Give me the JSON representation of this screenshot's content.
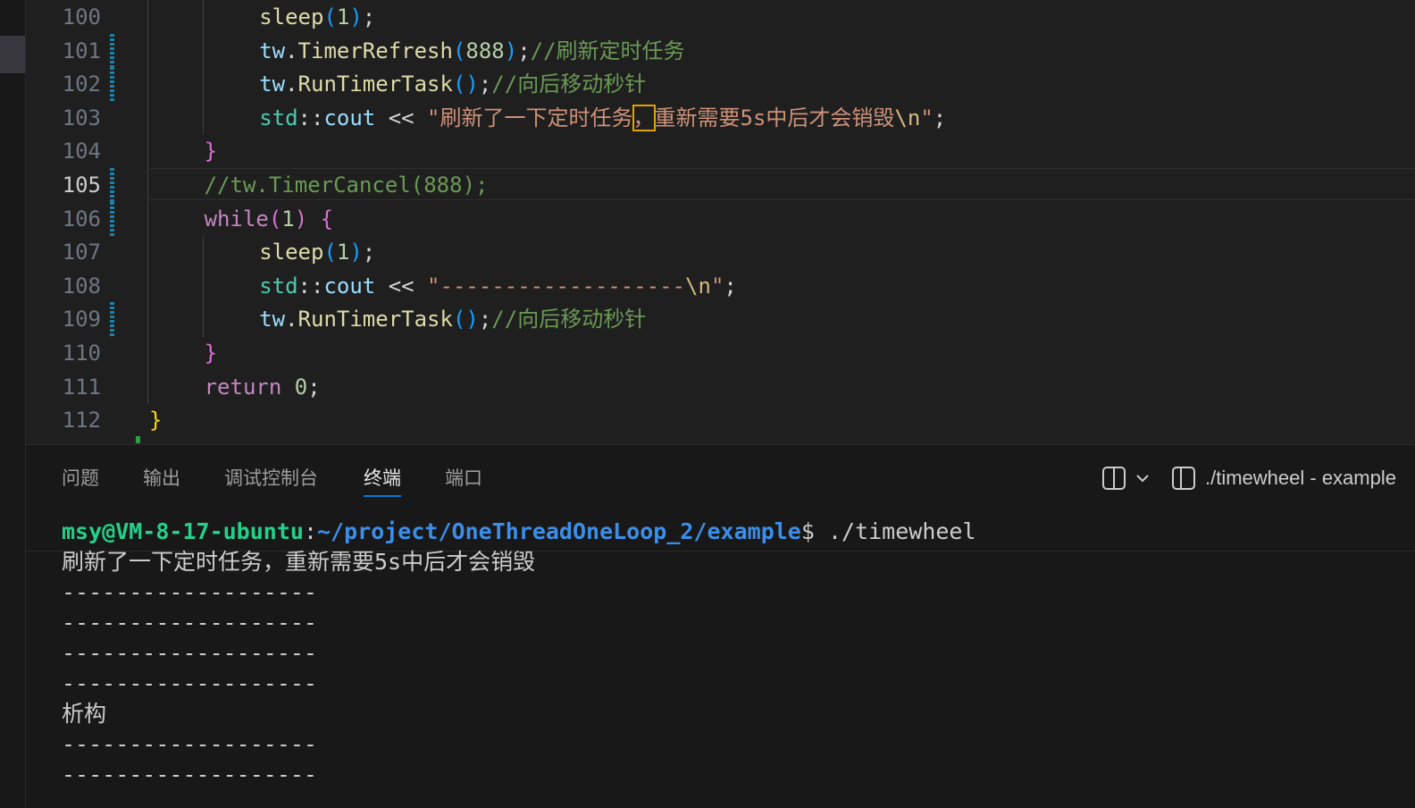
{
  "editor": {
    "lines": [
      {
        "num": "100",
        "indent": "        ",
        "tokens": [
          {
            "t": "sleep",
            "c": "t-fn"
          },
          {
            "t": "(",
            "c": "t-paren"
          },
          {
            "t": "1",
            "c": "t-num"
          },
          {
            "t": ")",
            "c": "t-paren"
          },
          {
            "t": ";",
            "c": "t-op"
          }
        ]
      },
      {
        "num": "101",
        "indent": "        ",
        "modified": true,
        "tokens": [
          {
            "t": "tw",
            "c": "t-var"
          },
          {
            "t": ".",
            "c": "t-op"
          },
          {
            "t": "TimerRefresh",
            "c": "t-fn"
          },
          {
            "t": "(",
            "c": "t-paren"
          },
          {
            "t": "888",
            "c": "t-num"
          },
          {
            "t": ")",
            "c": "t-paren"
          },
          {
            "t": ";",
            "c": "t-op"
          },
          {
            "t": "//刷新定时任务",
            "c": "t-cm"
          }
        ]
      },
      {
        "num": "102",
        "indent": "        ",
        "modified": true,
        "tokens": [
          {
            "t": "tw",
            "c": "t-var"
          },
          {
            "t": ".",
            "c": "t-op"
          },
          {
            "t": "RunTimerTask",
            "c": "t-fn"
          },
          {
            "t": "()",
            "c": "t-paren"
          },
          {
            "t": ";",
            "c": "t-op"
          },
          {
            "t": "//向后移动秒针",
            "c": "t-cm"
          }
        ]
      },
      {
        "num": "103",
        "indent": "        ",
        "tokens": [
          {
            "t": "std",
            "c": "t-ns"
          },
          {
            "t": "::",
            "c": "t-op"
          },
          {
            "t": "cout",
            "c": "t-var"
          },
          {
            "t": " << ",
            "c": "t-op"
          },
          {
            "t": "\"刷新了一下定时任务",
            "c": "t-str"
          },
          {
            "t": "，",
            "c": "t-str hl-box"
          },
          {
            "t": "重新需要5s中后才会销毁",
            "c": "t-str"
          },
          {
            "t": "\\n",
            "c": "t-esc"
          },
          {
            "t": "\"",
            "c": "t-str"
          },
          {
            "t": ";",
            "c": "t-op"
          }
        ]
      },
      {
        "num": "104",
        "indent": "    ",
        "tokens": [
          {
            "t": "}",
            "c": "t-brace"
          }
        ]
      },
      {
        "num": "105",
        "indent": "    ",
        "modified": true,
        "active": true,
        "tokens": [
          {
            "t": "//tw.TimerCancel(888);",
            "c": "t-cm"
          }
        ]
      },
      {
        "num": "106",
        "indent": "    ",
        "modified": true,
        "tokens": [
          {
            "t": "while",
            "c": "t-kw"
          },
          {
            "t": "(",
            "c": "t-brace"
          },
          {
            "t": "1",
            "c": "t-num"
          },
          {
            "t": ")",
            "c": "t-brace"
          },
          {
            "t": " ",
            "c": "t-op"
          },
          {
            "t": "{",
            "c": "t-brace"
          }
        ]
      },
      {
        "num": "107",
        "indent": "        ",
        "tokens": [
          {
            "t": "sleep",
            "c": "t-fn"
          },
          {
            "t": "(",
            "c": "t-paren"
          },
          {
            "t": "1",
            "c": "t-num"
          },
          {
            "t": ")",
            "c": "t-paren"
          },
          {
            "t": ";",
            "c": "t-op"
          }
        ]
      },
      {
        "num": "108",
        "indent": "        ",
        "tokens": [
          {
            "t": "std",
            "c": "t-ns"
          },
          {
            "t": "::",
            "c": "t-op"
          },
          {
            "t": "cout",
            "c": "t-var"
          },
          {
            "t": " << ",
            "c": "t-op"
          },
          {
            "t": "\"-------------------",
            "c": "t-str"
          },
          {
            "t": "\\n",
            "c": "t-esc"
          },
          {
            "t": "\"",
            "c": "t-str"
          },
          {
            "t": ";",
            "c": "t-op"
          }
        ]
      },
      {
        "num": "109",
        "indent": "        ",
        "modified": true,
        "tokens": [
          {
            "t": "tw",
            "c": "t-var"
          },
          {
            "t": ".",
            "c": "t-op"
          },
          {
            "t": "RunTimerTask",
            "c": "t-fn"
          },
          {
            "t": "()",
            "c": "t-paren"
          },
          {
            "t": ";",
            "c": "t-op"
          },
          {
            "t": "//向后移动秒针",
            "c": "t-cm"
          }
        ]
      },
      {
        "num": "110",
        "indent": "    ",
        "tokens": [
          {
            "t": "}",
            "c": "t-brace"
          }
        ]
      },
      {
        "num": "111",
        "indent": "    ",
        "tokens": [
          {
            "t": "return",
            "c": "t-kw"
          },
          {
            "t": " ",
            "c": "t-op"
          },
          {
            "t": "0",
            "c": "t-num"
          },
          {
            "t": ";",
            "c": "t-op"
          }
        ]
      },
      {
        "num": "112",
        "indent": "",
        "tokens": [
          {
            "t": "}",
            "c": "t-brace-y"
          }
        ]
      }
    ]
  },
  "panel": {
    "tabs": [
      {
        "label": "问题",
        "active": false
      },
      {
        "label": "输出",
        "active": false
      },
      {
        "label": "调试控制台",
        "active": false
      },
      {
        "label": "终端",
        "active": true
      },
      {
        "label": "端口",
        "active": false
      }
    ],
    "actions": {
      "split_icon": "split-terminal-icon",
      "dropdown_icon": "chevron-down-icon",
      "terminal_icon": "terminal-split-icon",
      "terminal_title": "./timewheel - example"
    }
  },
  "terminal": {
    "prompt_user": "msy@VM-8-17-ubuntu",
    "prompt_sep": ":",
    "prompt_path": "~/project/OneThreadOneLoop_2/example",
    "prompt_end": "$ ",
    "command": "./timewheel",
    "output": [
      "刷新了一下定时任务，重新需要5s中后才会销毁",
      "-------------------",
      "-------------------",
      "-------------------",
      "-------------------",
      "析构",
      "-------------------",
      "-------------------"
    ]
  },
  "colors": {
    "background": "#1f1f1f",
    "panel_background": "#181818",
    "accent": "#0078d4",
    "prompt_user": "#23d18b",
    "prompt_path": "#3b8eea"
  }
}
